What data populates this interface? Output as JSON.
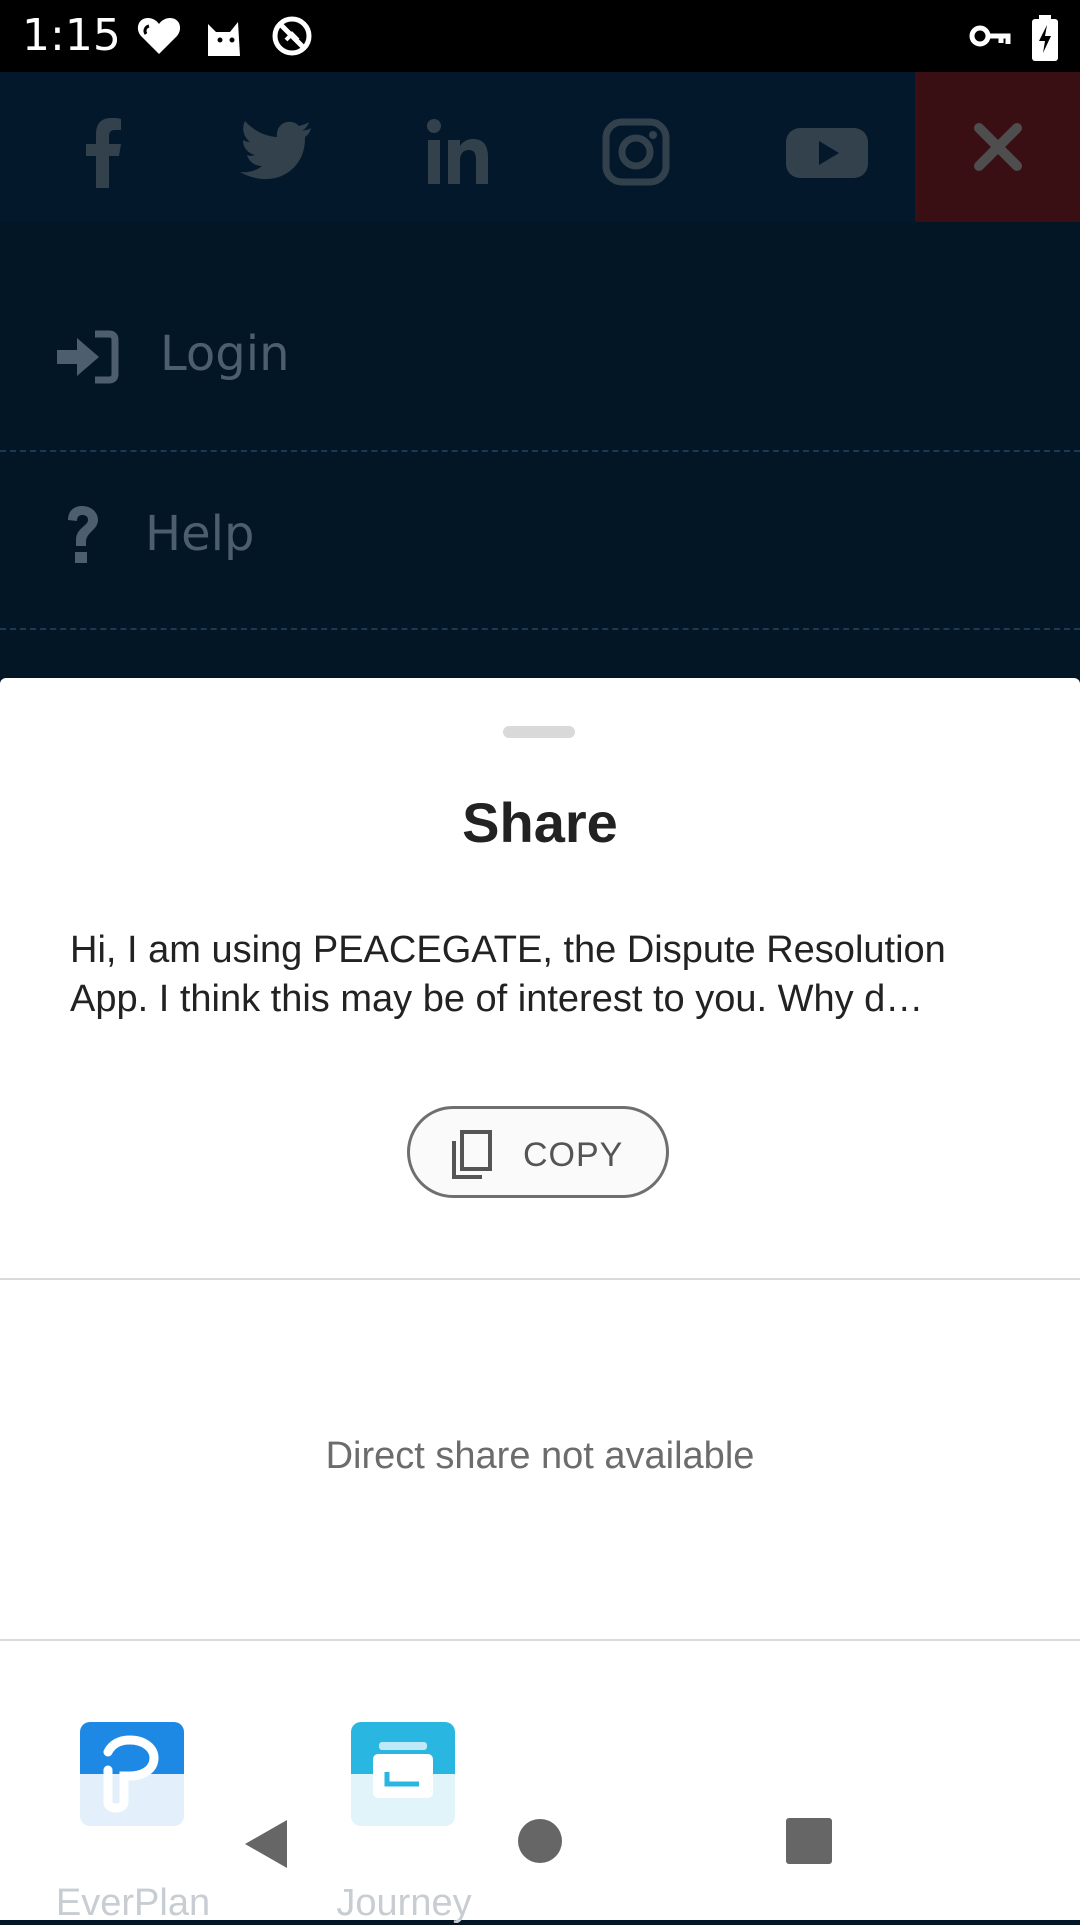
{
  "status_bar": {
    "time": "1:15",
    "left_icons": [
      "heart-icon",
      "cat-icon",
      "sync-icon"
    ],
    "right_icons": [
      "key-icon",
      "battery-charging-icon"
    ]
  },
  "background_app": {
    "social_icons": [
      "facebook-icon",
      "twitter-icon",
      "linkedin-icon",
      "instagram-icon",
      "youtube-icon"
    ],
    "close_icon": "close-icon",
    "menu": [
      {
        "label": "Login",
        "icon": "login-icon"
      },
      {
        "label": "Help",
        "icon": "help-icon"
      }
    ]
  },
  "share_sheet": {
    "title": "Share",
    "message_line1": "Hi, I am using PEACEGATE, the Dispute Resolution",
    "message_line2": "App. I think this may be of interest to you. Why d…",
    "copy_label": "COPY",
    "direct_share_text": "Direct share not available",
    "apps": [
      {
        "name": "EverPlan",
        "icon": "everplan-icon"
      },
      {
        "name": "Journey",
        "icon": "journey-icon"
      }
    ]
  },
  "nav_bar": {
    "buttons": [
      "back-icon",
      "home-icon",
      "recents-icon"
    ]
  },
  "colors": {
    "app_background": "#021626",
    "close_box": "#3a0f14",
    "everplan_blue": "#1e88e5",
    "journey_cyan": "#29b6e0"
  }
}
